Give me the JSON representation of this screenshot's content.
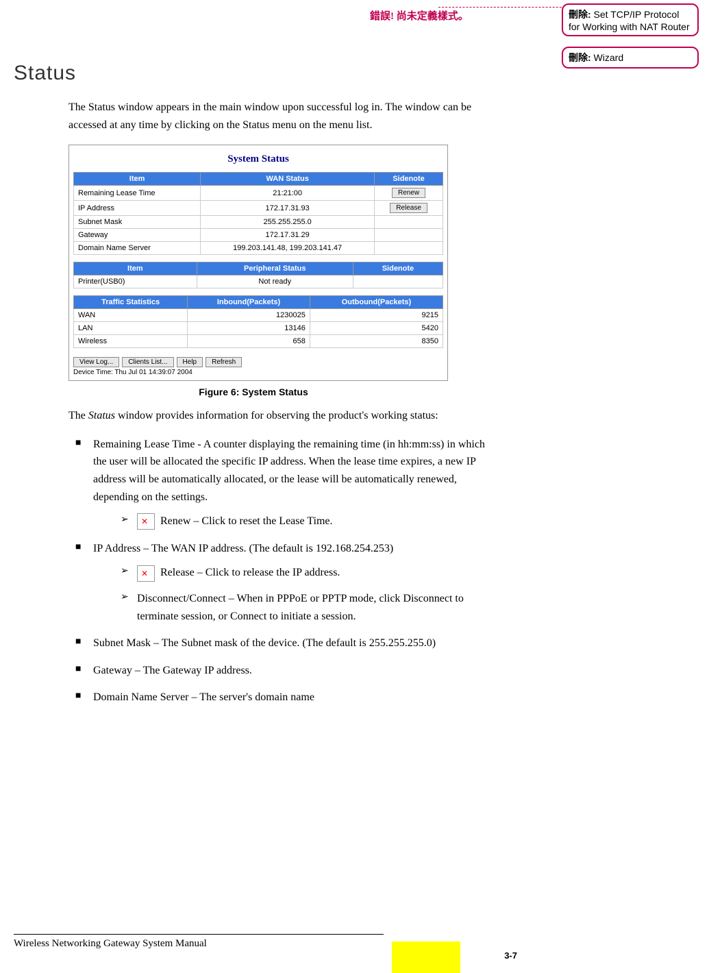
{
  "header_error": "錯誤! 尚未定義樣式。",
  "annotations": [
    {
      "label": "刪除:",
      "text": " Set TCP/IP Protocol for Working with NAT Router"
    },
    {
      "label": "刪除:",
      "text": " Wizard"
    }
  ],
  "heading": "Status",
  "intro": "The Status window appears in the main window upon successful log in. The window can be accessed at any time by clicking on the Status menu on the menu list.",
  "fig": {
    "title": "System Status",
    "caption": "Figure 6: System Status",
    "wan": {
      "headers": [
        "Item",
        "WAN Status",
        "Sidenote"
      ],
      "rows": [
        {
          "item": "Remaining Lease Time",
          "val": "21:21:00",
          "btn": "Renew"
        },
        {
          "item": "IP Address",
          "val": "172.17.31.93",
          "btn": "Release"
        },
        {
          "item": "Subnet Mask",
          "val": "255.255.255.0",
          "btn": ""
        },
        {
          "item": "Gateway",
          "val": "172.17.31.29",
          "btn": ""
        },
        {
          "item": "Domain Name Server",
          "val": "199.203.141.48, 199.203.141.47",
          "btn": ""
        }
      ]
    },
    "periph": {
      "headers": [
        "Item",
        "Peripheral Status",
        "Sidenote"
      ],
      "rows": [
        {
          "item": "Printer(USB0)",
          "val": "Not ready",
          "side": ""
        }
      ]
    },
    "traffic": {
      "headers": [
        "Traffic Statistics",
        "Inbound(Packets)",
        "Outbound(Packets)"
      ],
      "rows": [
        {
          "item": "WAN",
          "in": "1230025",
          "out": "9215"
        },
        {
          "item": "LAN",
          "in": "13146",
          "out": "5420"
        },
        {
          "item": "Wireless",
          "in": "658",
          "out": "8350"
        }
      ]
    },
    "buttons": [
      "View Log...",
      "Clients List...",
      "Help",
      "Refresh"
    ],
    "device_time": "Device Time: Thu Jul 01 14:39:07 2004"
  },
  "after_fig": "The Status window provides information for observing the product's working status:",
  "after_fig_em": "Status",
  "bullets": {
    "b1": "Remaining Lease Time - A counter displaying the remaining time (in hh:mm:ss) in which the user will be allocated the specific IP address. When the lease time expires, a new IP address will be automatically allocated, or the lease will be automatically renewed, depending on the settings.",
    "b1a": "Renew – Click to reset the Lease Time.",
    "b2": "IP Address – The WAN IP address. (The default is 192.168.254.253)",
    "b2a": "Release – Click to release the IP address.",
    "b2b": "Disconnect/Connect – When in PPPoE or PPTP mode, click Disconnect to terminate session, or Connect to initiate a session.",
    "b3": "Subnet Mask – The Subnet mask of the device. (The default is 255.255.255.0)",
    "b4": "Gateway – The Gateway IP address.",
    "b5": "Domain Name Server – The server's domain name"
  },
  "footer": "Wireless Networking Gateway System Manual",
  "page_num": "3-7"
}
